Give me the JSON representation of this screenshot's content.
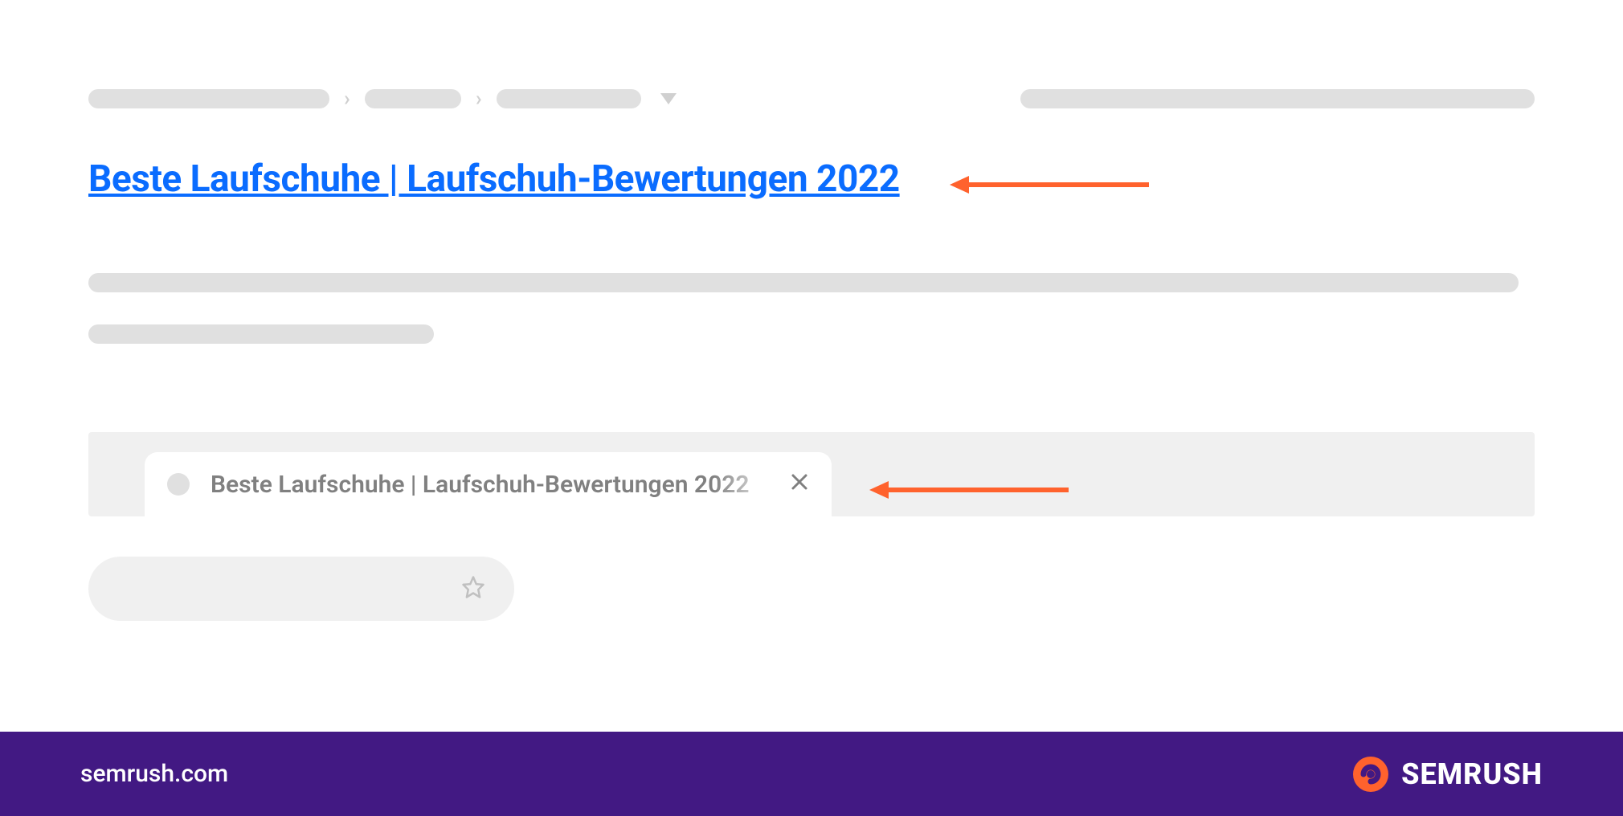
{
  "serp": {
    "title_link": "Beste Laufschuhe | Laufschuh-Bewertungen 2022"
  },
  "browser": {
    "tab_title": "Beste Laufschuhe | Laufschuh-Bewertungen 2022"
  },
  "footer": {
    "domain": "semrush.com",
    "brand": "SEMRUSH"
  },
  "colors": {
    "link_blue": "#0a6cff",
    "accent_orange": "#ff622d",
    "footer_purple": "#421983",
    "placeholder_grey": "#e0e0e0"
  }
}
